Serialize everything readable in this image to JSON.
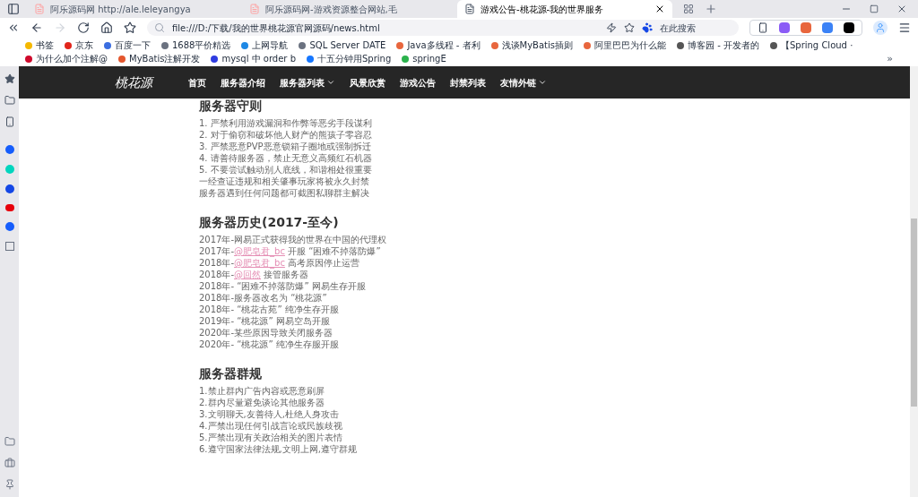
{
  "browser": {
    "tabs": [
      {
        "label": "阿乐源码网 http://ale.leleyangya",
        "selected": false
      },
      {
        "label": "阿乐源码网-游戏资源整合网站,毛",
        "selected": false
      },
      {
        "label": "游戏公告-桃花源-我的世界服务",
        "selected": true
      }
    ],
    "address": "file:///D:/下载/我的世界桃花源官网源码/news.html",
    "search_placeholder": "在此搜索",
    "bookmarks": [
      {
        "label": "书签",
        "color": "#f5b800"
      },
      {
        "label": "京东",
        "color": "#e1251b"
      },
      {
        "label": "百度一下",
        "color": "#3b6ee0"
      },
      {
        "label": "1688平价精选",
        "color": "#6b7280"
      },
      {
        "label": "上网导航",
        "color": "#1e88e5"
      },
      {
        "label": "SQL Server DATE",
        "color": "#6b7280"
      },
      {
        "label": "Java多线程 - 者利",
        "color": "#e8663d"
      },
      {
        "label": "浅谈MyBatis插则",
        "color": "#e8663d"
      },
      {
        "label": "阿里巴巴为什么能",
        "color": "#e8663d"
      },
      {
        "label": "博客园 - 开发者的",
        "color": "#555555"
      },
      {
        "label": "【Spring Cloud ·",
        "color": "#555555"
      },
      {
        "label": "为什么加个注解@",
        "color": "#cf0a2c"
      },
      {
        "label": "MyBatis注解开发",
        "color": "#e4572e"
      },
      {
        "label": "mysql 中 order b",
        "color": "#2f3ce0"
      },
      {
        "label": "十五分钟用Spring",
        "color": "#1677ff"
      },
      {
        "label": "springE",
        "color": "#2bb24c"
      }
    ],
    "more": "»"
  },
  "site": {
    "logo": "桃花源",
    "nav": [
      {
        "label": "首页",
        "dropdown": false
      },
      {
        "label": "服务器介绍",
        "dropdown": false
      },
      {
        "label": "服务器列表",
        "dropdown": true
      },
      {
        "label": "风景欣赏",
        "dropdown": false
      },
      {
        "label": "游戏公告",
        "dropdown": false
      },
      {
        "label": "封禁列表",
        "dropdown": false
      },
      {
        "label": "友情外链",
        "dropdown": true
      }
    ]
  },
  "sections": [
    {
      "title": "服务器守则",
      "items": [
        {
          "text": "1. 严禁利用游戏漏洞和作弊等恶劣手段谋利"
        },
        {
          "text": "2. 对于偷窃和破坏他人财产的熊孩子零容忍"
        },
        {
          "text": "3. 严禁恶意PVP恶意锁箱子圈地或强制拆迁"
        },
        {
          "text": "4. 请善待服务器，禁止无意义高频红石机器"
        },
        {
          "text": "5. 不要尝试触动别人底线，和谐相处很重要"
        },
        {
          "text": "一经查证违规和相关肇事玩家将被永久封禁"
        },
        {
          "text": "服务器遇到任何问题都可截图私聊群主解决"
        }
      ]
    },
    {
      "title": "服务器历史(2017-至今)",
      "items": [
        {
          "text": "2017年-网易正式获得我的世界在中国的代理权"
        },
        {
          "text": "2017年-",
          "link": "@肥皂君_bc",
          "rest": " 开服 “困难不掉落防爆”"
        },
        {
          "text": "2018年-",
          "link": "@肥皂君_bc",
          "rest": " 高考原因停止运营"
        },
        {
          "text": "2018年-",
          "link": "@回然",
          "rest": " 接管服务器"
        },
        {
          "text": "2018年- “困难不掉落防爆” 网易生存开服"
        },
        {
          "text": "2018年-服务器改名为 “桃花源”"
        },
        {
          "text": "2018年- “桃花古苑” 纯净生存开服"
        },
        {
          "text": "2019年- “桃花源” 网易空岛开服"
        },
        {
          "text": "2020年-某些原因导致关闭服务器"
        },
        {
          "text": "2020年- “桃花源” 纯净生存服开服"
        }
      ]
    },
    {
      "title": "服务器群规",
      "items": [
        {
          "text": "1.禁止群内广告内容或恶意刷屏"
        },
        {
          "text": "2.群内尽量避免谈论其他服务器"
        },
        {
          "text": "3.文明聊天,友善待人,杜绝人身攻击"
        },
        {
          "text": "4.严禁出现任何引战言论或民族歧视"
        },
        {
          "text": "5.严禁出现有关政治相关的图片表情"
        },
        {
          "text": "6.遵守国家法律法规,文明上网,遵守群规"
        }
      ]
    }
  ]
}
